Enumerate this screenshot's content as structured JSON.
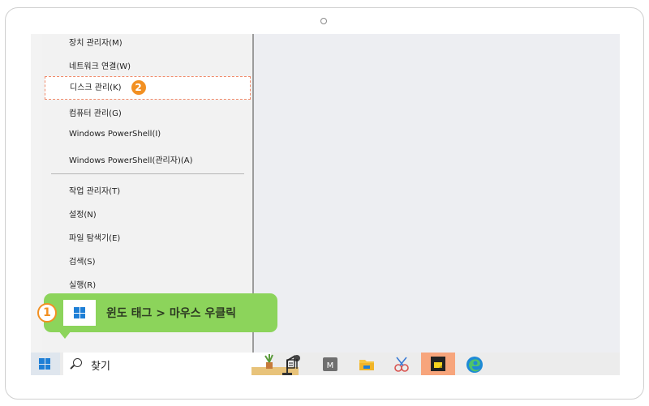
{
  "menu": {
    "items": [
      {
        "label": "장치 관리자(M)"
      },
      {
        "label": "네트워크 연결(W)"
      },
      {
        "label": "디스크 관리(K)",
        "highlighted": true,
        "step": "2"
      },
      {
        "label": "컴퓨터 관리(G)"
      },
      {
        "label": "Windows PowerShell(I)"
      },
      {
        "label": "Windows PowerShell(관리자)(A)"
      },
      {
        "label": "작업 관리자(T)"
      },
      {
        "label": "설정(N)"
      },
      {
        "label": "파일 탐색기(E)"
      },
      {
        "label": "검색(S)"
      },
      {
        "label": "실행(R)"
      }
    ]
  },
  "callout": {
    "step": "1",
    "text": "윈도 태그 > 마우스 우클릭"
  },
  "taskbar": {
    "search_text": "찾기",
    "icons": [
      "windows-start-icon",
      "search-icon",
      "task-view-icon",
      "m-app-icon",
      "file-explorer-icon",
      "snipping-tool-icon",
      "sticky-notes-icon",
      "edge-icon"
    ]
  },
  "colors": {
    "accent_orange": "#f29022",
    "callout_green": "#8cd45b",
    "highlight_border": "#f08a6a",
    "windows_blue": "#1e7fd6"
  }
}
